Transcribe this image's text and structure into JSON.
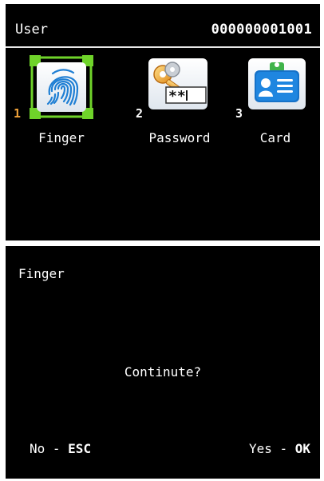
{
  "header": {
    "title": "User",
    "user_id": "000000001001"
  },
  "options": [
    {
      "number": "1",
      "label": "Finger",
      "icon": "fingerprint-icon",
      "selected": true
    },
    {
      "number": "2",
      "label": "Password",
      "icon": "key-password-icon",
      "selected": false
    },
    {
      "number": "3",
      "label": "Card",
      "icon": "id-card-icon",
      "selected": false
    }
  ],
  "dialog": {
    "title": "Finger",
    "prompt": "Continute?",
    "no_label": "No - ",
    "no_key": "ESC",
    "yes_label": "Yes - ",
    "yes_key": "OK"
  },
  "colors": {
    "background": "#000000",
    "selection": "#6fd32a",
    "selected_number": "#f2a33a",
    "text": "#ffffff"
  }
}
